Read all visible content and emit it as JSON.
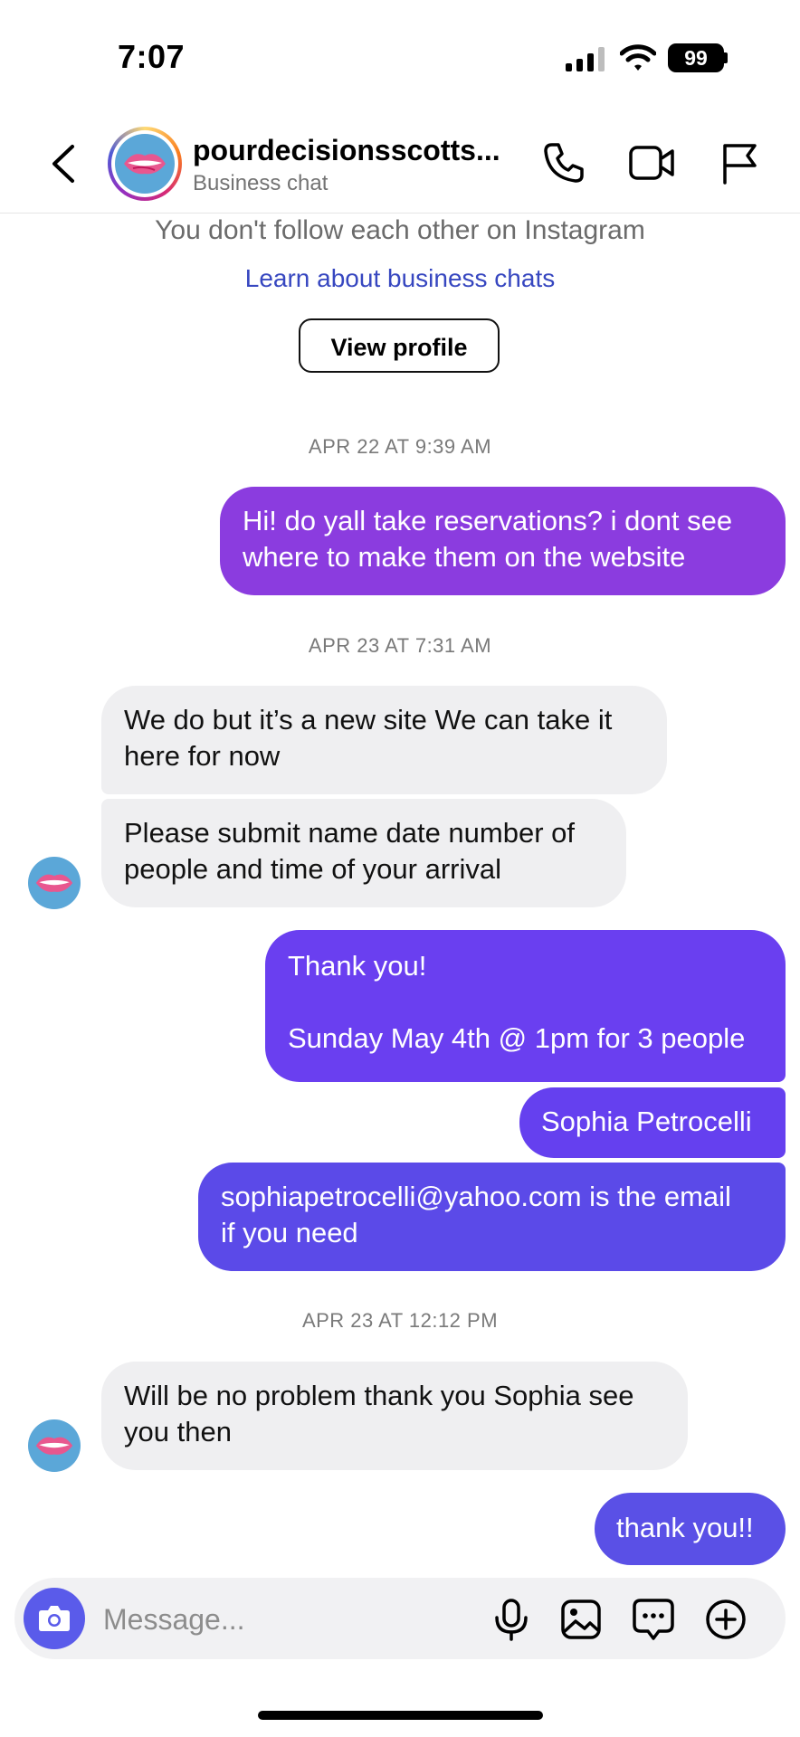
{
  "status_bar": {
    "time": "7:07",
    "battery": "99"
  },
  "header": {
    "name": "pourdecisionsscotts...",
    "subtitle": "Business chat",
    "icons": [
      "back-icon",
      "phone-icon",
      "video-icon",
      "flag-icon"
    ]
  },
  "intro": {
    "follow_note": "You don't follow each other on Instagram",
    "learn_link": "Learn about business chats",
    "view_profile": "View profile"
  },
  "timestamps": {
    "t1": "APR 22 AT 9:39 AM",
    "t2": "APR 23 AT 7:31 AM",
    "t3": "APR 23 AT 12:12 PM"
  },
  "messages": {
    "m1": "Hi! do yall take reservations? i dont see\nwhere to make them on the website",
    "m2": "We do but it’s a new site We can take it\nhere for now",
    "m3": "Please submit name date number of\npeople and time of your arrival",
    "m4": "Thank you!\n\nSunday May 4th @ 1pm for 3 people",
    "m5": "Sophia Petrocelli",
    "m6": "sophiapetrocelli@yahoo.com is the email\nif you need",
    "m7": "Will be no problem thank you Sophia see\nyou then",
    "m8": "thank you!!"
  },
  "colors": {
    "bubble_out_1": "#8b3cdf",
    "bubble_out_2": "#6a3ff0",
    "bubble_out_3": "#5b4ae8",
    "bubble_in": "#efeff1",
    "link": "#3747c0",
    "camera": "#5a5bea"
  },
  "composer": {
    "placeholder": "Message...",
    "icons": [
      "camera-icon",
      "microphone-icon",
      "gallery-icon",
      "sticker-icon",
      "plus-icon"
    ]
  }
}
